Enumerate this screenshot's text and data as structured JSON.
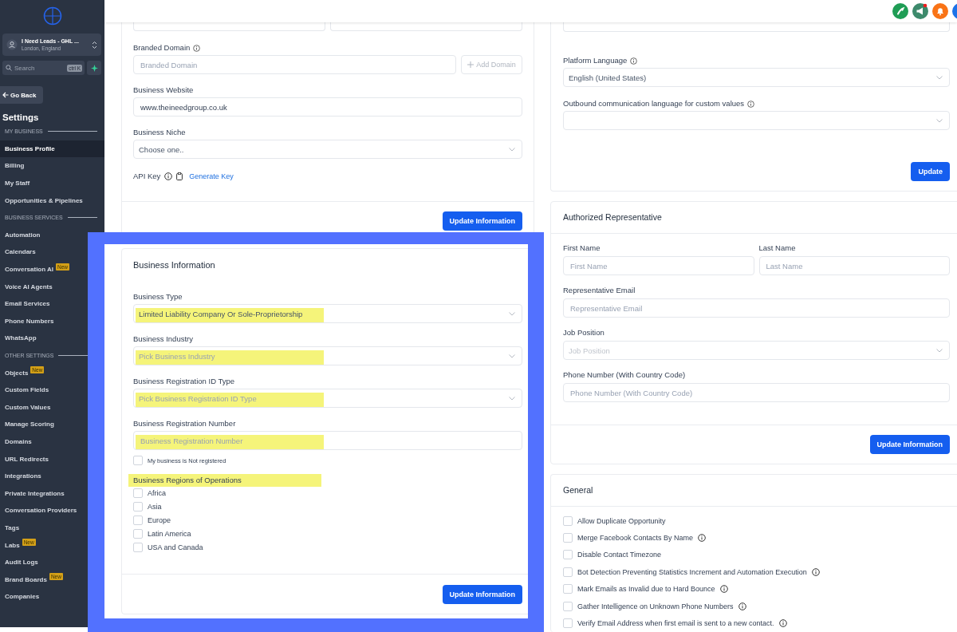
{
  "sidebar": {
    "account": {
      "name": "I Need Leads - GHL ...",
      "location": "London, England"
    },
    "search": {
      "placeholder": "Search",
      "shortcut": "ctrl K"
    },
    "back_button": "Go Back",
    "title": "Settings",
    "sections": [
      {
        "heading": "MY BUSINESS",
        "items": [
          {
            "label": "Business Profile",
            "selected": true
          },
          {
            "label": "Billing",
            "selected": false
          },
          {
            "label": "My Staff",
            "selected": false
          },
          {
            "label": "Opportunities & Pipelines",
            "selected": false
          }
        ]
      },
      {
        "heading": "BUSINESS SERVICES",
        "items": [
          {
            "label": "Automation",
            "selected": false
          },
          {
            "label": "Calendars",
            "selected": false
          },
          {
            "label": "Conversation AI",
            "selected": false,
            "badge": "New"
          },
          {
            "label": "Voice AI Agents",
            "selected": false
          },
          {
            "label": "Email Services",
            "selected": false
          },
          {
            "label": "Phone Numbers",
            "selected": false
          },
          {
            "label": "WhatsApp",
            "selected": false
          }
        ]
      },
      {
        "heading": "OTHER SETTINGS",
        "items": [
          {
            "label": "Objects",
            "selected": false,
            "badge": "New"
          },
          {
            "label": "Custom Fields",
            "selected": false
          },
          {
            "label": "Custom Values",
            "selected": false
          },
          {
            "label": "Manage Scoring",
            "selected": false
          },
          {
            "label": "Domains",
            "selected": false
          },
          {
            "label": "URL Redirects",
            "selected": false
          },
          {
            "label": "Integrations",
            "selected": false
          },
          {
            "label": "Private Integrations",
            "selected": false
          },
          {
            "label": "Conversation Providers",
            "selected": false
          },
          {
            "label": "Tags",
            "selected": false
          },
          {
            "label": "Labs",
            "selected": false,
            "badge": "New"
          },
          {
            "label": "Audit Logs",
            "selected": false
          },
          {
            "label": "Brand Boards",
            "selected": false,
            "badge": "New"
          },
          {
            "label": "Companies",
            "selected": false
          }
        ]
      }
    ]
  },
  "company_card": {
    "fields": [
      {
        "kind": "input_action",
        "label": "Branded Domain",
        "info": true,
        "placeholder": "Branded Domain",
        "action": "Add Domain"
      },
      {
        "kind": "input",
        "label": "Business Website",
        "value": "www.theineedgroup.co.uk"
      },
      {
        "kind": "select",
        "label": "Business Niche",
        "value": "Choose one.."
      }
    ],
    "api_key": {
      "label": "API Key",
      "link": "Generate Key"
    },
    "button": "Update Information"
  },
  "business_info": {
    "title": "Business Information",
    "fields": [
      {
        "kind": "select",
        "label": "Business Type",
        "value": "Limited Liability Company Or Sole-Proprietorship",
        "highlighted": true
      },
      {
        "kind": "select",
        "label": "Business Industry",
        "placeholder": "Pick Business Industry",
        "highlighted": true
      },
      {
        "kind": "select",
        "label": "Business Registration ID Type",
        "placeholder": "Pick Business Registration ID Type",
        "highlighted": true
      },
      {
        "kind": "input",
        "label": "Business Registration Number",
        "placeholder": "Business Registration Number",
        "highlighted": true
      }
    ],
    "not_registered": {
      "label": "My business is Not registered",
      "checked": false
    },
    "regions": {
      "label": "Business Regions of Operations",
      "highlighted": true,
      "options": [
        {
          "label": "Africa",
          "checked": false
        },
        {
          "label": "Asia",
          "checked": false
        },
        {
          "label": "Europe",
          "checked": false
        },
        {
          "label": "Latin America",
          "checked": false
        },
        {
          "label": "USA and Canada",
          "checked": false
        }
      ]
    },
    "button": "Update Information"
  },
  "language_card": {
    "fields": [
      {
        "kind": "select",
        "label": "Platform Language",
        "info": true,
        "value": "English (United States)"
      },
      {
        "kind": "select",
        "label": "Outbound communication language for custom values",
        "info": true
      }
    ],
    "button": "Update"
  },
  "representative": {
    "title": "Authorized Representative",
    "name_fields": [
      {
        "kind": "input",
        "label": "First Name",
        "placeholder": "First Name"
      },
      {
        "kind": "input",
        "label": "Last Name",
        "placeholder": "Last Name"
      }
    ],
    "fields": [
      {
        "kind": "input",
        "label": "Representative Email",
        "placeholder": "Representative Email"
      },
      {
        "kind": "select",
        "label": "Job Position",
        "placeholder": "Job Position"
      },
      {
        "kind": "input",
        "label": "Phone Number (With Country Code)",
        "placeholder": "Phone Number (With Country Code)"
      }
    ],
    "button": "Update Information"
  },
  "general": {
    "title": "General",
    "options": [
      {
        "label": "Allow Duplicate Opportunity",
        "checked": false,
        "info": false
      },
      {
        "label": "Merge Facebook Contacts By Name",
        "checked": false,
        "info": true
      },
      {
        "label": "Disable Contact Timezone",
        "checked": false,
        "info": false
      },
      {
        "label": "Bot Detection Preventing Statistics Increment and Automation Execution",
        "checked": false,
        "info": true
      },
      {
        "label": "Mark Emails as Invalid due to Hard Bounce",
        "checked": false,
        "info": true
      },
      {
        "label": "Gather Intelligence on Unknown Phone Numbers",
        "checked": false,
        "info": true
      },
      {
        "label": "Verify Email Address when first email is sent to a new contact.",
        "checked": false,
        "info": true
      }
    ]
  }
}
